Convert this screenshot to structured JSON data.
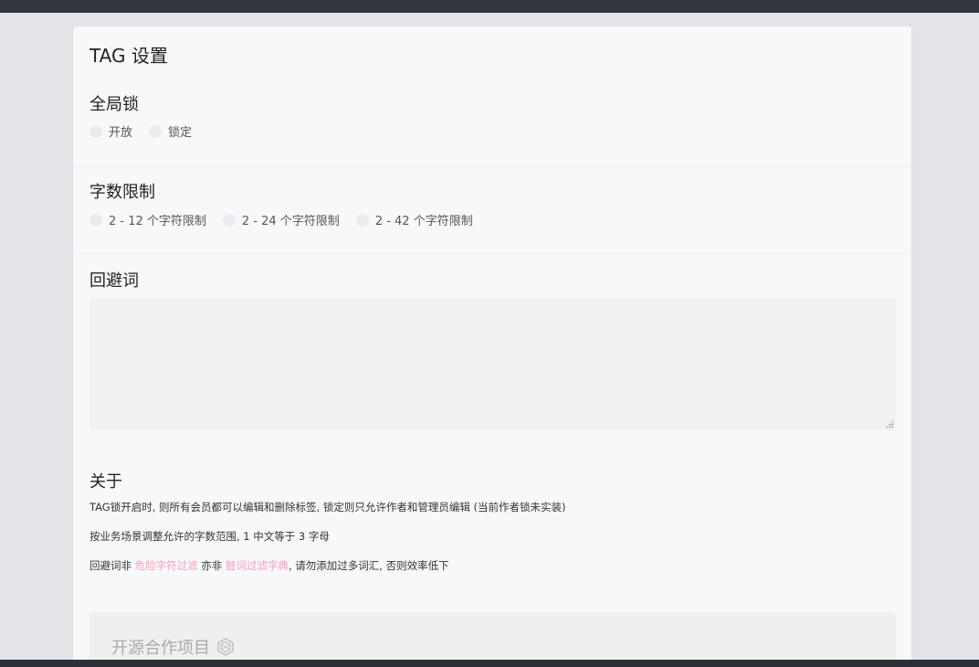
{
  "page": {
    "title": "TAG 设置"
  },
  "global_lock": {
    "title": "全局锁",
    "options": [
      {
        "label": "开放"
      },
      {
        "label": "锁定"
      }
    ]
  },
  "char_limit": {
    "title": "字数限制",
    "options": [
      {
        "label": "2 - 12 个字符限制"
      },
      {
        "label": "2 - 24 个字符限制"
      },
      {
        "label": "2 - 42 个字符限制"
      }
    ]
  },
  "avoid_words": {
    "title": "回避词",
    "value": ""
  },
  "about": {
    "title": "关于",
    "line1": "TAG锁开启时, 则所有会员都可以编辑和删除标签, 锁定则只允许作者和管理员编辑 (当前作者锁未实装)",
    "line2": "按业务场景调整允许的字数范围, 1 中文等于 3 字母",
    "line3_prefix": "回避词非 ",
    "line3_link1": "危险字符过滤",
    "line3_mid": " 亦非 ",
    "line3_link2": "脏词过滤字典",
    "line3_suffix": ", 请勿添加过多词汇, 否则效率低下"
  },
  "footer": {
    "title": "开源合作项目"
  },
  "colors": {
    "accent_link": "#f49bbf",
    "topbar": "#323640",
    "panel": "#f7f8fa"
  }
}
